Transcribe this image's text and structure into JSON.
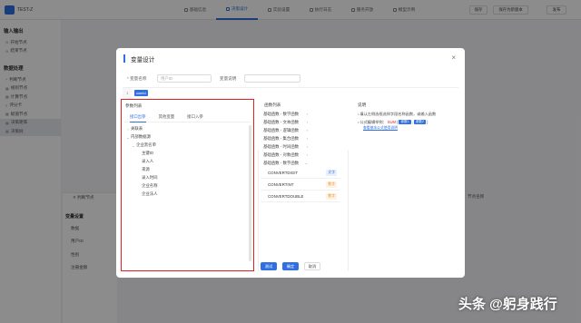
{
  "app": {
    "title": "TEST-Z"
  },
  "nav": {
    "tabs": [
      "基础信息",
      "决策设计",
      "实验设置",
      "执行日志",
      "服务开放",
      "模型示例"
    ]
  },
  "toolbar": {
    "btn1": "保存",
    "btn2": "保存为新版本",
    "btn3": "发布"
  },
  "sidebar": {
    "section1": "输入输出",
    "section1_items": [
      "开始节点",
      "结束节点"
    ],
    "section2": "数据处理",
    "section2_items": [
      "判断节点",
      "规则节点",
      "计算节点",
      "评分卡",
      "赋值节点",
      "决策矩阵",
      "决策树"
    ]
  },
  "background": {
    "panel_title": "判断节点",
    "section": "变量设置",
    "rows": [
      "数据",
      "用户ID",
      "性别",
      "注册金额"
    ],
    "right_header": "节点名称"
  },
  "modal": {
    "title": "变量设计",
    "name_label": "* 变量名称",
    "name_placeholder": "用户ID",
    "desc_label": "变量说明",
    "line_no": "1",
    "code_token": "userId",
    "param": {
      "title": "参数列表",
      "tabs": [
        "接口出参",
        "其他变量",
        "接口入参"
      ],
      "tree": [
        {
          "label": "关联表",
          "arrow": "›",
          "indent": 0
        },
        {
          "label": "内部数据源",
          "arrow": "⌄",
          "indent": 0
        },
        {
          "label": "企业黑名单",
          "arrow": "⌄",
          "indent": 1
        },
        {
          "label": "主键ID",
          "arrow": "",
          "indent": 2
        },
        {
          "label": "录入人",
          "arrow": "",
          "indent": 2
        },
        {
          "label": "来源",
          "arrow": "",
          "indent": 2
        },
        {
          "label": "录入时间",
          "arrow": "",
          "indent": 2
        },
        {
          "label": "企业名称",
          "arrow": "",
          "indent": 2
        },
        {
          "label": "企业法人",
          "arrow": "",
          "indent": 2
        }
      ]
    },
    "func": {
      "title": "函数列表",
      "groups": [
        "基础函数 - 数学函数",
        "基础函数 - 文本函数",
        "基础函数 - 逻辑函数",
        "基础函数 - 集合函数",
        "基础函数 - 时间函数",
        "基础函数 - 对象函数",
        "基础函数 - 数字函数"
      ],
      "items": [
        {
          "name": "CONVERTDIGIT",
          "type": "文字"
        },
        {
          "name": "CONVERTINT",
          "type": "数字"
        },
        {
          "name": "CONVERTDOUBLE",
          "type": "数字"
        }
      ]
    },
    "desc": {
      "title": "说明",
      "line1": "填认左侧选框选择字段名称函数，或输入函数",
      "line2_label": "公式编辑举例：",
      "line2_func": "SUM",
      "line2_tag1": "参数1",
      "line2_tag2": "参数2",
      "link": "查看基本公式使用说明"
    },
    "buttons": {
      "test": "测试",
      "confirm": "确定",
      "cancel": "取消"
    }
  },
  "watermark": {
    "text": "头条 @躬身践行"
  },
  "colors": {
    "accent": "#2f6fe0",
    "highlight_border": "#e02020"
  }
}
